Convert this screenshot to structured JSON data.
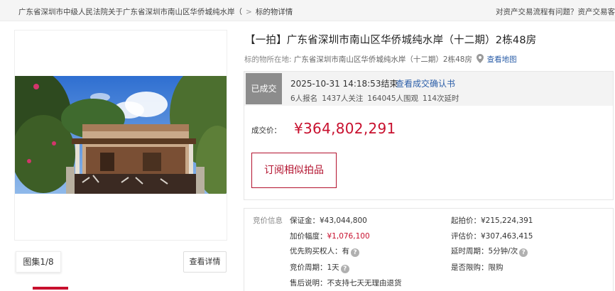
{
  "breadcrumb": {
    "items": [
      "广东省深圳市中级人民法院关于广东省深圳市南山区华侨城纯水岸（",
      "标的物详情"
    ],
    "separator": ">"
  },
  "help_text": "对资产交易流程有问题？资产交易客",
  "gallery": {
    "counter_label": "图集",
    "counter_value": "1/8",
    "detail_button": "查看详情"
  },
  "listing": {
    "title": "【一拍】广东省深圳市南山区华侨城纯水岸（十二期）2栋48房",
    "location_label": "标的物所在地:",
    "location_value": "广东省深圳市南山区华侨城纯水岸（十二期）2栋48房",
    "map_link": "查看地图"
  },
  "status": {
    "badge": "已成交",
    "end_time": "2025-10-31 14:18:53结束",
    "confirm_link": "查看成交确认书",
    "signups": "6人报名",
    "followers": "1437人关注",
    "views": "164045人围观",
    "extensions": "114次延时",
    "price_label": "成交价：",
    "price_value": "¥364,802,291",
    "subscribe_button": "订阅相似拍品"
  },
  "bid_info": {
    "title": "竞价信息",
    "deposit": {
      "label": "保证金：",
      "value": "¥43,044,800"
    },
    "increment": {
      "label": "加价幅度：",
      "value": "¥1,076,100"
    },
    "priority": {
      "label": "优先购买权人：",
      "value": "有"
    },
    "cycle": {
      "label": "竞价周期：",
      "value": "1天"
    },
    "after_sale": {
      "label": "售后说明：",
      "value": "不支持七天无理由退货"
    },
    "start_price": {
      "label": "起拍价：",
      "value": "¥215,224,391"
    },
    "appraisal": {
      "label": "评估价：",
      "value": "¥307,463,415"
    },
    "delay": {
      "label": "延时周期：",
      "value": "5分钟/次"
    },
    "purchase_limit": {
      "label": "是否限购：",
      "value": "限购"
    }
  },
  "colors": {
    "accent_red": "#c8102e",
    "link_blue": "#2b5ea8",
    "status_gray": "#8c8c8c"
  }
}
